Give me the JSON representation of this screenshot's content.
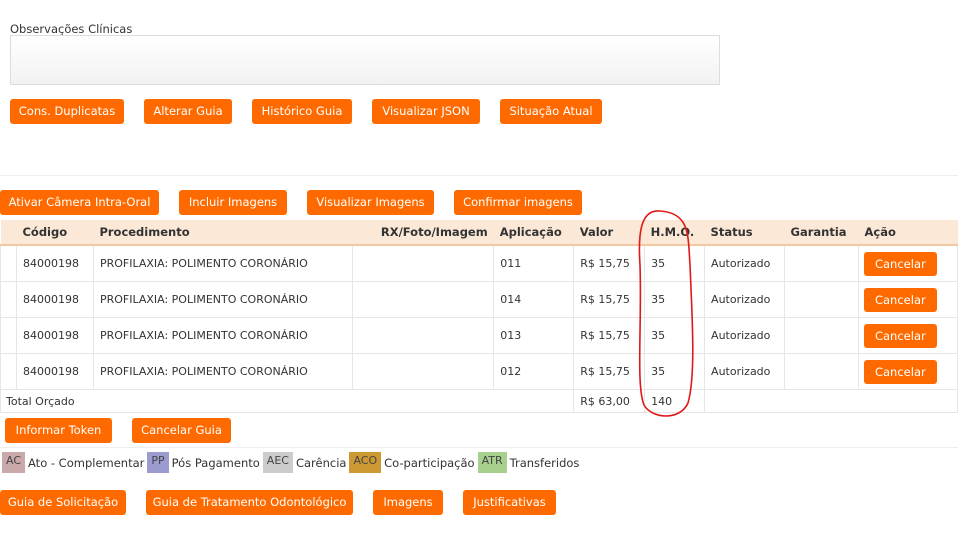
{
  "observacoes": {
    "label": "Observações Clínicas",
    "value": ""
  },
  "top_buttons": [
    "Cons. Duplicatas",
    "Alterar Guia",
    "Histórico Guia",
    "Visualizar JSON",
    "Situação Atual"
  ],
  "image_buttons": [
    "Ativar Câmera Intra-Oral",
    "Incluir Imagens",
    "Visualizar Imagens",
    "Confirmar imagens"
  ],
  "table": {
    "headers": [
      "Código",
      "Procedimento",
      "RX/Foto/Imagem",
      "Aplicação",
      "Valor",
      "H.M.O.",
      "Status",
      "Garantia",
      "Ação"
    ],
    "rows": [
      {
        "codigo": "84000198",
        "procedimento": "PROFILAXIA: POLIMENTO CORONÁRIO",
        "rx": "",
        "aplicacao": "011",
        "valor": "R$ 15,75",
        "hmo": "35",
        "status": "Autorizado",
        "garantia": "",
        "acao": "Cancelar"
      },
      {
        "codigo": "84000198",
        "procedimento": "PROFILAXIA: POLIMENTO CORONÁRIO",
        "rx": "",
        "aplicacao": "014",
        "valor": "R$ 15,75",
        "hmo": "35",
        "status": "Autorizado",
        "garantia": "",
        "acao": "Cancelar"
      },
      {
        "codigo": "84000198",
        "procedimento": "PROFILAXIA: POLIMENTO CORONÁRIO",
        "rx": "",
        "aplicacao": "013",
        "valor": "R$ 15,75",
        "hmo": "35",
        "status": "Autorizado",
        "garantia": "",
        "acao": "Cancelar"
      },
      {
        "codigo": "84000198",
        "procedimento": "PROFILAXIA: POLIMENTO CORONÁRIO",
        "rx": "",
        "aplicacao": "012",
        "valor": "R$ 15,75",
        "hmo": "35",
        "status": "Autorizado",
        "garantia": "",
        "acao": "Cancelar"
      }
    ],
    "total": {
      "label": "Total Orçado",
      "valor": "R$ 63,00",
      "hmo": "140"
    }
  },
  "action_buttons": [
    "Informar Token",
    "Cancelar Guia"
  ],
  "legend": [
    {
      "code": "AC",
      "label": "Ato - Complementar",
      "color": "#c9a9a9"
    },
    {
      "code": "PP",
      "label": "Pós Pagamento",
      "color": "#9b9bd0"
    },
    {
      "code": "AEC",
      "label": "Carência",
      "color": "#cccccc"
    },
    {
      "code": "ACO",
      "label": "Co-participação",
      "color": "#cc9933"
    },
    {
      "code": "ATR",
      "label": "Transferidos",
      "color": "#a8d08d"
    }
  ],
  "bottom_buttons": [
    "Guia de Solicitação",
    "Guia de Tratamento Odontológico",
    "Imagens",
    "Justificativas"
  ]
}
